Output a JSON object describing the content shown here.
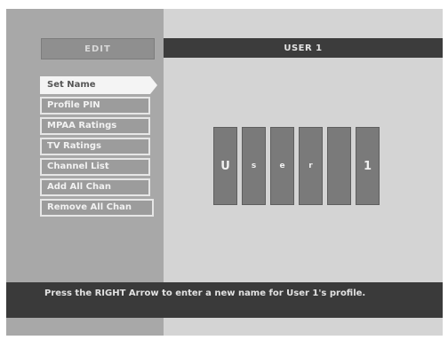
{
  "left_panel": {
    "edit_label": "EDIT",
    "menu_items": [
      {
        "label": "Set Name",
        "selected": true
      },
      {
        "label": "Profile PIN",
        "selected": false
      },
      {
        "label": "MPAA Ratings",
        "selected": false
      },
      {
        "label": "TV Ratings",
        "selected": false
      },
      {
        "label": "Channel List",
        "selected": false
      },
      {
        "label": "Add All Chan",
        "selected": false
      },
      {
        "label": "Remove All Chan",
        "selected": false
      }
    ]
  },
  "main": {
    "title": "USER 1",
    "name_chars": [
      "U",
      "s",
      "e",
      "r",
      "",
      "1"
    ]
  },
  "status": {
    "message": "Press the RIGHT Arrow to enter a new name for User 1's profile."
  },
  "colors": {
    "screen_bg": "#d4d4d4",
    "left_panel_bg": "#a8a8a8",
    "bar_bg": "#3a3a3a",
    "selected_bg": "#f4f4f4",
    "char_box_bg": "#7a7a7a"
  }
}
